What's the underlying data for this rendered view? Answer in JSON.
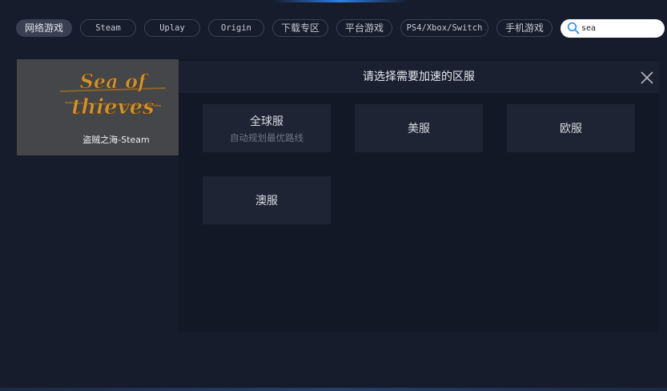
{
  "tabs": [
    {
      "label": "网络游戏",
      "active": true
    },
    {
      "label": "Steam"
    },
    {
      "label": "Uplay"
    },
    {
      "label": "Origin"
    },
    {
      "label": "下载专区"
    },
    {
      "label": "平台游戏"
    },
    {
      "label": "PS4/Xbox/Switch"
    },
    {
      "label": "手机游戏"
    }
  ],
  "search": {
    "value": "sea",
    "icon": "search-icon"
  },
  "game": {
    "title": "盗贼之海-Steam",
    "logo_text": [
      "Sea of",
      "thieves"
    ],
    "logo_color": "#c9933a"
  },
  "region_dialog": {
    "title": "请选择需要加速的区服",
    "close_icon": "close-icon",
    "regions": [
      {
        "name": "全球服",
        "subtitle": "自动规划最优路线"
      },
      {
        "name": "美服"
      },
      {
        "name": "欧服"
      },
      {
        "name": "澳服"
      }
    ]
  },
  "colors": {
    "background": "#161c2c",
    "panel": "#131826",
    "region_button": "#1e2433",
    "accent": "#2f7fe6"
  }
}
